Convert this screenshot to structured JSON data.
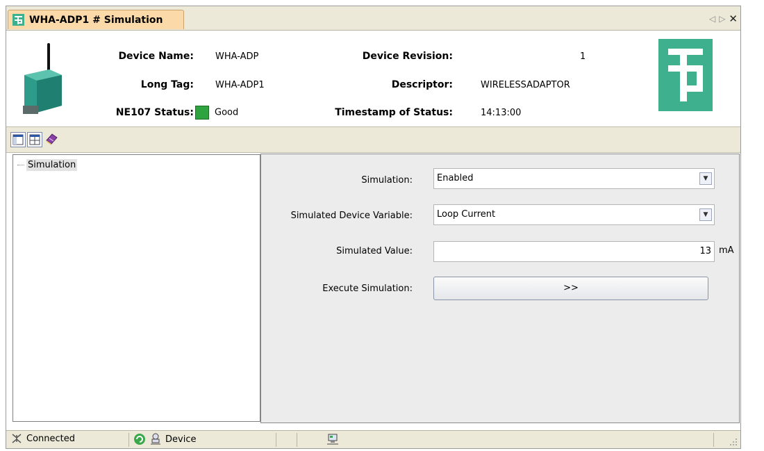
{
  "tab": {
    "title": "WHA-ADP1 # Simulation",
    "logo_letter": "f̲p"
  },
  "header": {
    "device_name_label": "Device Name:",
    "device_name": "WHA-ADP",
    "long_tag_label": "Long Tag:",
    "long_tag": "WHA-ADP1",
    "ne107_label": "NE107 Status:",
    "ne107_value": "Good",
    "device_revision_label": "Device Revision:",
    "device_revision": "1",
    "descriptor_label": "Descriptor:",
    "descriptor": "WIRELESSADAPTOR",
    "timestamp_label": "Timestamp of Status:",
    "timestamp": "14:13:00",
    "status_color": "#2fa33f",
    "brand_color": "#3fb08e"
  },
  "tree": {
    "items": [
      {
        "label": "Simulation"
      }
    ]
  },
  "panel": {
    "simulation_label": "Simulation:",
    "simulation_value": "Enabled",
    "variable_label": "Simulated Device Variable:",
    "variable_value": "Loop Current",
    "value_label": "Simulated Value:",
    "value": "13",
    "unit": "mA",
    "execute_label": "Execute Simulation:",
    "execute_button": ">>"
  },
  "statusbar": {
    "connection": "Connected",
    "device": "Device"
  }
}
